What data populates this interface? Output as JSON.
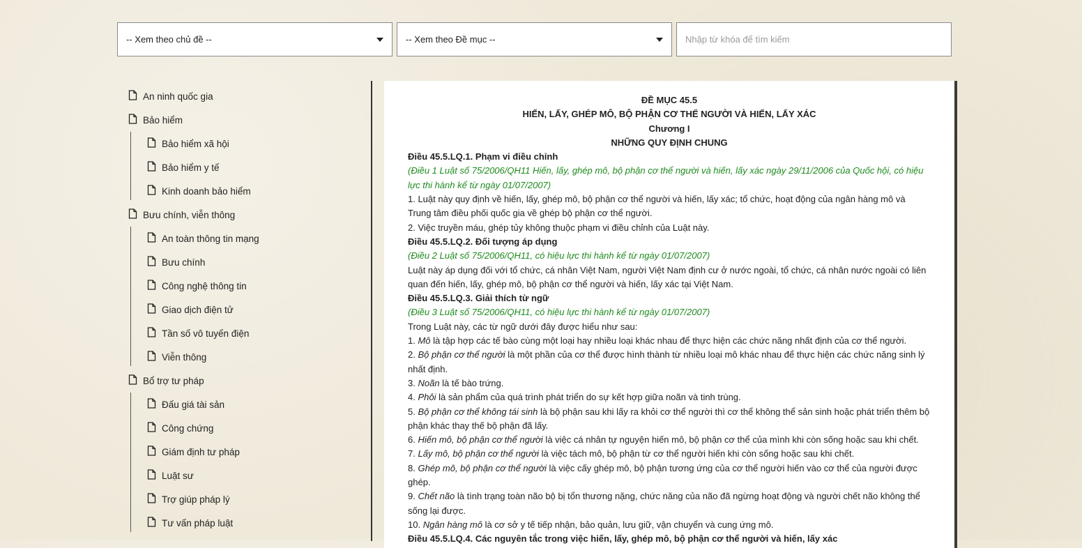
{
  "filters": {
    "topic_select": "-- Xem theo chủ đề --",
    "section_select": "-- Xem theo Đề mục --",
    "search_placeholder": "Nhập từ khóa để tìm kiếm"
  },
  "sidebar": [
    {
      "label": "An ninh quốc gia",
      "children": []
    },
    {
      "label": "Bảo hiểm",
      "children": [
        "Bảo hiểm xã hội",
        "Bảo hiểm y tế",
        "Kinh doanh bảo hiểm"
      ]
    },
    {
      "label": "Bưu chính, viễn thông",
      "children": [
        "An toàn thông tin mạng",
        "Bưu chính",
        "Công nghệ thông tin",
        "Giao dịch điện tử",
        "Tần số vô tuyến điện",
        "Viễn thông"
      ]
    },
    {
      "label": "Bổ trợ tư pháp",
      "children": [
        "Đấu giá tài sản",
        "Công chứng",
        "Giám định tư pháp",
        "Luật sư",
        "Trợ giúp pháp lý",
        "Tư vấn pháp luật"
      ]
    }
  ],
  "document": [
    {
      "type": "center",
      "text": "ĐỀ MỤC 45.5"
    },
    {
      "type": "center",
      "text": "HIẾN, LẤY, GHÉP MÔ, BỘ PHẬN CƠ THỂ NGƯỜI VÀ HIẾN, LẤY XÁC"
    },
    {
      "type": "center",
      "text": "Chương I"
    },
    {
      "type": "center",
      "text": "NHỮNG QUY ĐỊNH CHUNG"
    },
    {
      "type": "article",
      "text": "Điều 45.5.LQ.1. Phạm vi điều chỉnh"
    },
    {
      "type": "note",
      "text": "(Điều 1 Luật số 75/2006/QH11 Hiến, lấy, ghép mô, bộ phận cơ thể người và hiến, lấy xác ngày 29/11/2006 của Quốc hội, có hiệu lực thi hành kể từ ngày 01/07/2007)"
    },
    {
      "type": "p",
      "text": "1. Luật này quy định về hiến, lấy, ghép mô, bộ phận cơ thể người và hiến, lấy xác; tổ chức, hoạt động của ngân hàng mô và Trung tâm điều phối quốc gia về ghép bộ phận cơ thể người."
    },
    {
      "type": "p",
      "text": "2. Việc truyền máu, ghép tủy không thuộc phạm vi điều chỉnh của Luật này."
    },
    {
      "type": "article",
      "text": "Điều 45.5.LQ.2. Đối tượng áp dụng"
    },
    {
      "type": "note",
      "text": "(Điều 2 Luật số 75/2006/QH11, có hiệu lực thi hành kể từ ngày 01/07/2007)"
    },
    {
      "type": "p",
      "text": "Luật này áp dụng đối với tổ chức, cá nhân Việt Nam, người Việt Nam định cư ở nước ngoài, tổ chức, cá nhân nước ngoài có liên quan đến hiến, lấy, ghép mô, bộ phận cơ thể người và hiến, lấy xác tại Việt Nam."
    },
    {
      "type": "article",
      "text": "Điều 45.5.LQ.3. Giải thích từ ngữ"
    },
    {
      "type": "note",
      "text": "(Điều 3 Luật số 75/2006/QH11, có hiệu lực thi hành kể từ ngày 01/07/2007)"
    },
    {
      "type": "p",
      "text": "Trong Luật này, các từ ngữ dưới đây được hiểu như sau:"
    },
    {
      "type": "def",
      "num": "1. ",
      "term": "Mô",
      "text": " là tập hợp các tế bào cùng một loại hay nhiều loại khác nhau để thực hiện các chức năng nhất định của cơ thể người."
    },
    {
      "type": "def",
      "num": "2. ",
      "term": "Bộ phận cơ thể người",
      "text": " là một phần của cơ thể được hình thành từ nhiều loại mô khác nhau để thực hiện các chức năng sinh lý nhất định."
    },
    {
      "type": "def",
      "num": "3. ",
      "term": "Noãn",
      "text": " là tế bào trứng."
    },
    {
      "type": "def",
      "num": "4. ",
      "term": "Phôi",
      "text": " là sản phẩm của quá trình phát triển do sự kết hợp giữa noãn và tinh trùng."
    },
    {
      "type": "def",
      "num": "5. ",
      "term": "Bộ phận cơ thể không tái sinh",
      "text": " là bộ phận sau khi lấy ra khỏi cơ thể người thì cơ thể không thể sản sinh hoặc phát triển thêm bộ phận khác thay thế bộ phận đã lấy."
    },
    {
      "type": "def",
      "num": "6. ",
      "term": "Hiến mô, bộ phận cơ thể người",
      "text": " là việc cá nhân tự nguyện hiến mô, bộ phận cơ thể của mình khi còn sống hoặc sau khi chết."
    },
    {
      "type": "def",
      "num": "7. ",
      "term": "Lấy mô, bộ phận cơ thể người",
      "text": " là việc tách mô, bộ phận từ cơ thể người hiến khi còn sống hoặc sau khi chết."
    },
    {
      "type": "def",
      "num": "8. ",
      "term": "Ghép mô, bộ phận cơ thể người",
      "text": " là việc cấy ghép mô, bộ phận tương ứng của cơ thể người hiến vào cơ thể của người được ghép."
    },
    {
      "type": "def",
      "num": "9. ",
      "term": "Chết não",
      "text": " là tình trạng toàn não bộ bị tổn thương nặng, chức năng của não đã ngừng hoạt động và người chết não không thể sống lại được."
    },
    {
      "type": "def",
      "num": "10. ",
      "term": "Ngân hàng mô",
      "text": " là cơ sở y tế tiếp nhận, bảo quản, lưu giữ, vận chuyển và cung ứng mô."
    },
    {
      "type": "article",
      "text": "Điều 45.5.LQ.4. Các nguyên tắc trong việc hiến, lấy, ghép mô, bộ phận cơ thể người và hiến, lấy xác"
    }
  ]
}
